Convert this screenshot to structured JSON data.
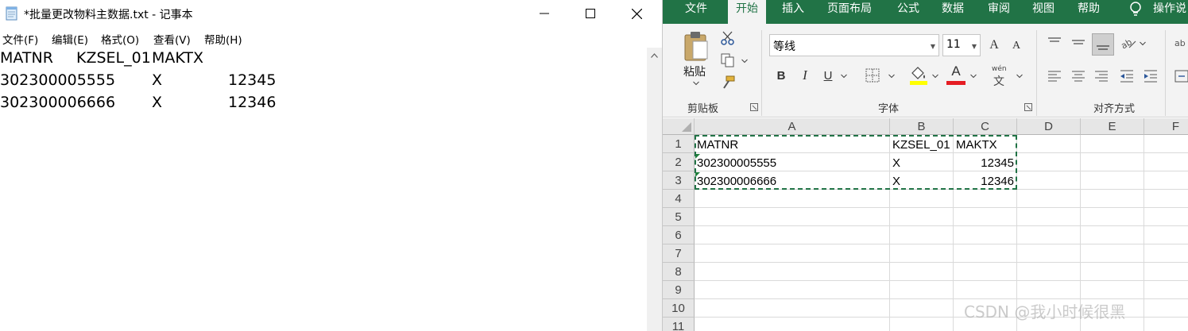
{
  "notepad": {
    "title": "*批量更改物料主数据.txt - 记事本",
    "window_buttons": {
      "minimize_icon": "minimize-icon",
      "maximize_icon": "maximize-icon",
      "close_icon": "close-icon"
    },
    "menu": [
      "文件(F)",
      "编辑(E)",
      "格式(O)",
      "查看(V)",
      "帮助(H)"
    ],
    "lines": [
      [
        "MATNR",
        "KZSEL_01",
        "MAKTX"
      ],
      [
        "302300005555",
        "X",
        "12345"
      ],
      [
        "302300006666",
        "X",
        "12346"
      ]
    ]
  },
  "excel": {
    "tabs": [
      "文件",
      "开始",
      "插入",
      "页面布局",
      "公式",
      "数据",
      "审阅",
      "视图",
      "帮助",
      "操作说"
    ],
    "active_tab": "开始",
    "ribbon": {
      "clipboard": {
        "paste_label": "粘贴",
        "group_label": "剪贴板"
      },
      "font": {
        "name": "等线",
        "size": "11",
        "group_label": "字体",
        "bold": "B",
        "italic": "I",
        "underline": "U",
        "grow": "A",
        "shrink": "A",
        "color_letter": "A",
        "phonetic_top": "wén",
        "phonetic_bottom": "文"
      },
      "alignment": {
        "group_label": "对齐方式"
      }
    },
    "columns": [
      "A",
      "B",
      "C",
      "D",
      "E",
      "F"
    ],
    "rows": [
      "1",
      "2",
      "3",
      "4",
      "5",
      "6",
      "7",
      "8",
      "9",
      "10",
      "11"
    ],
    "cells": [
      [
        "MATNR",
        "KZSEL_01",
        "MAKTX"
      ],
      [
        "302300005555",
        "X",
        "12345"
      ],
      [
        "302300006666",
        "X",
        "12346"
      ]
    ],
    "colors": {
      "brand": "#217346",
      "font_color_bar": "#e51c23",
      "highlight_bar": "#ffff00"
    }
  },
  "watermark": "CSDN @我小时候很黑"
}
